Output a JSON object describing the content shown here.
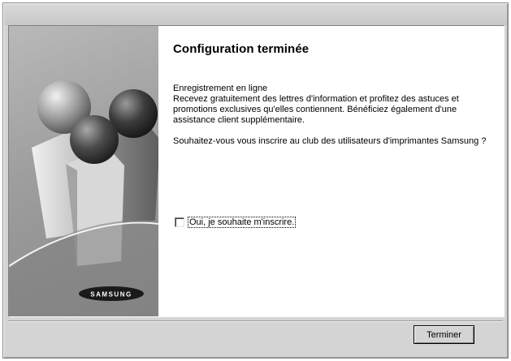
{
  "dialog": {
    "title": "Configuration terminée",
    "paragraphs": [
      "Enregistrement en ligne\nRecevez gratuitement des lettres d'information et profitez des astuces et promotions exclusives qu'elles contiennent. Bénéficiez également d'une assistance client supplémentaire.",
      "Souhaitez-vous vous inscrire au club des utilisateurs d'imprimantes Samsung ?"
    ],
    "checkbox": {
      "label": "Oui, je souhaite m'inscrire.",
      "checked": false
    },
    "finish_button": "Terminer"
  },
  "branding": {
    "logo_text": "SAMSUNG"
  },
  "colors": {
    "window_bg": "#d4d4d4",
    "side_panel": "#9e9e9e",
    "sphere_left": "#8a8a8a",
    "sphere_center": "#4a4a4a",
    "sphere_right": "#3c3c3c"
  }
}
